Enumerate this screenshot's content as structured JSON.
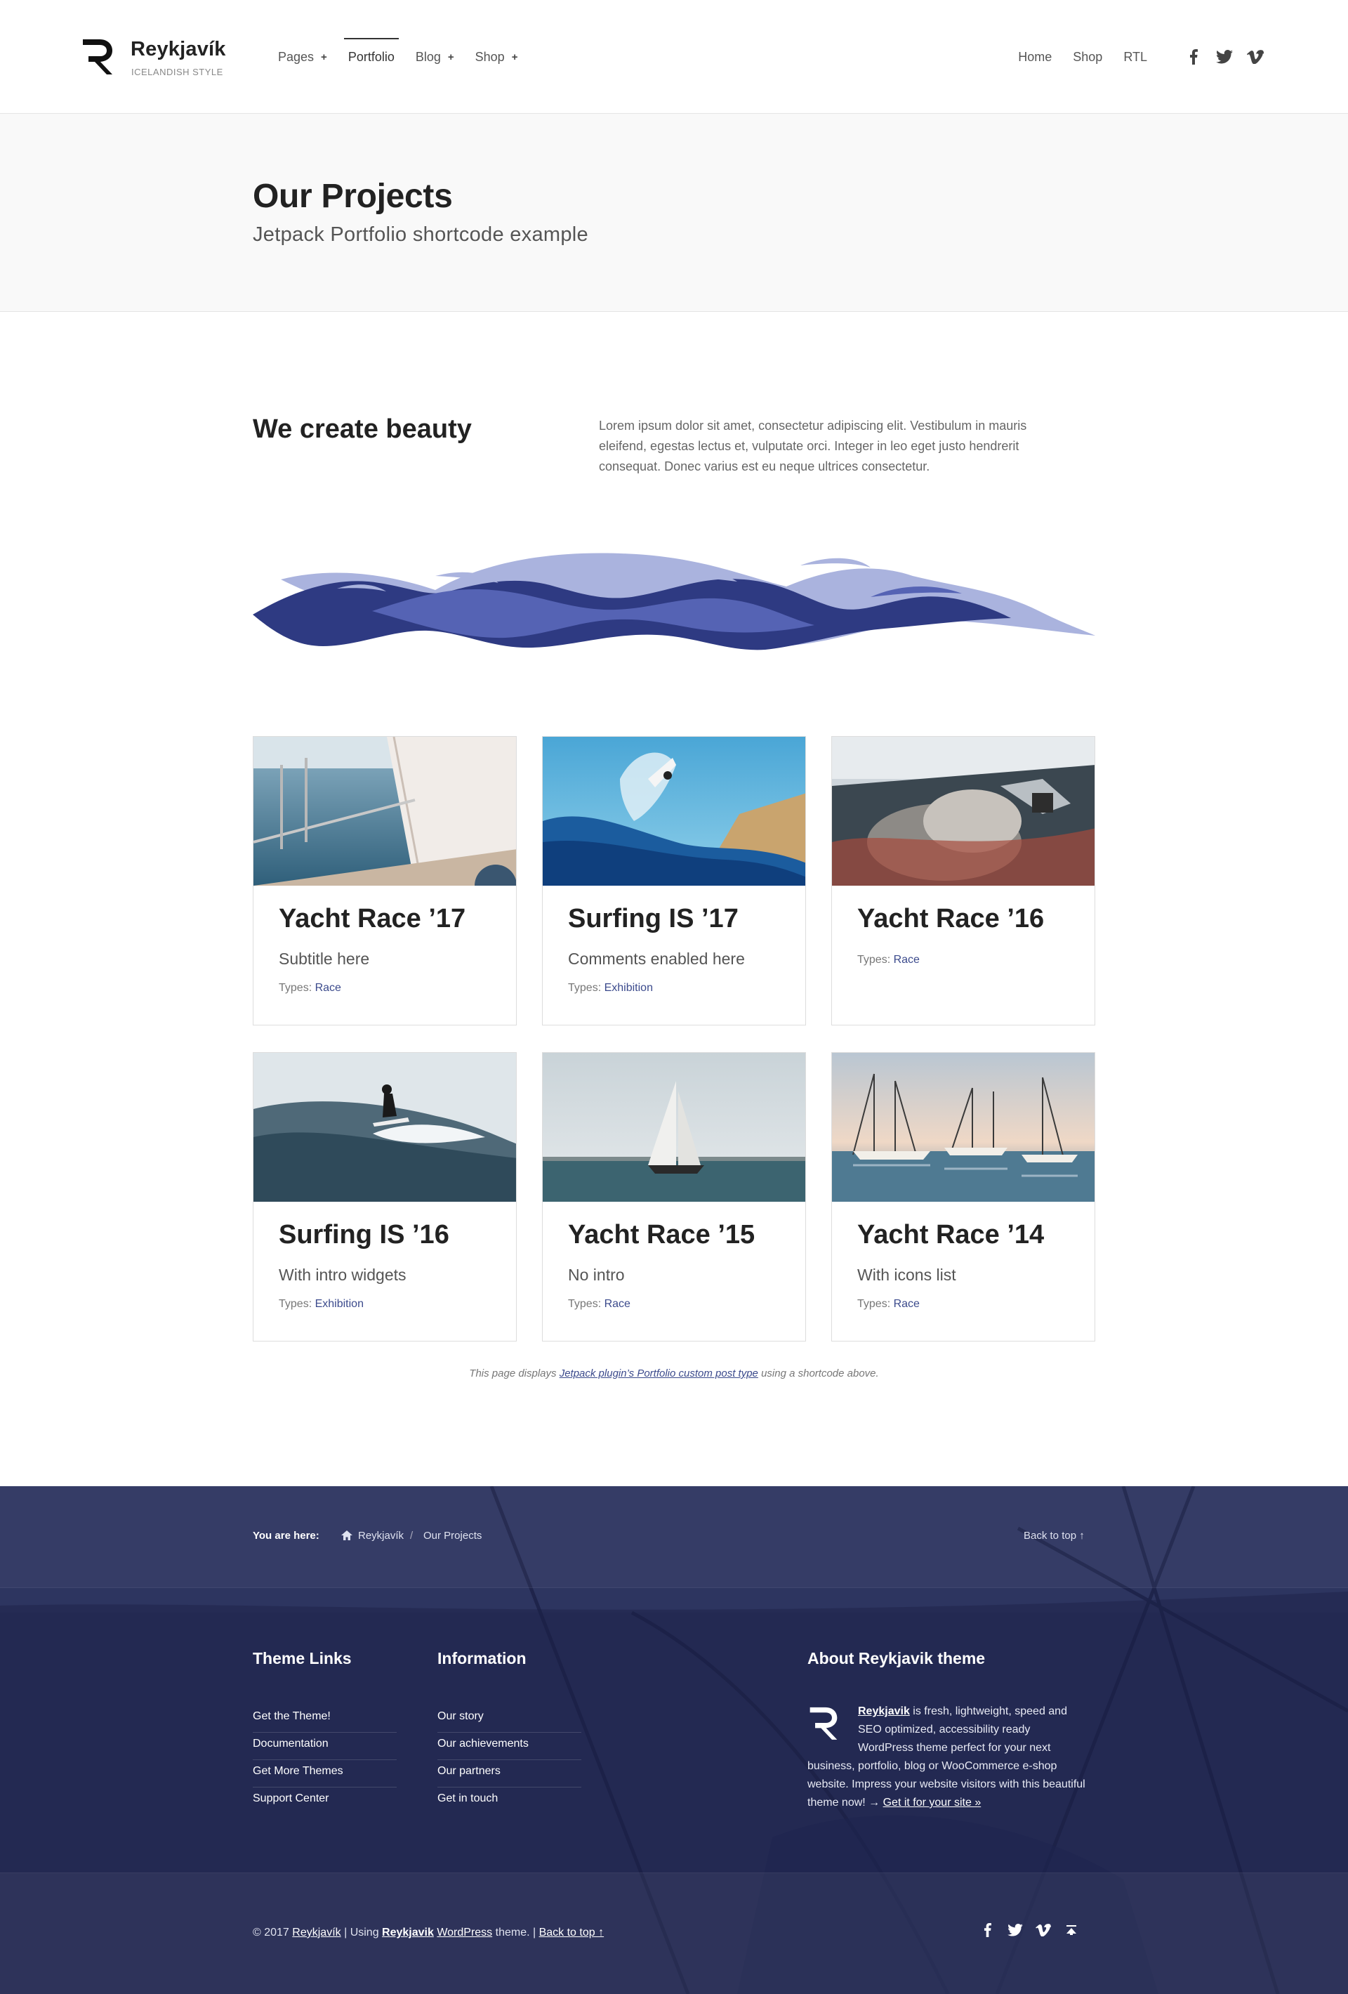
{
  "header": {
    "brand_name": "Reykjavík",
    "brand_tagline": "ICELANDISH STYLE",
    "nav": [
      {
        "label": "Pages",
        "has_sub": true
      },
      {
        "label": "Portfolio",
        "has_sub": false,
        "active": true
      },
      {
        "label": "Blog",
        "has_sub": true
      },
      {
        "label": "Shop",
        "has_sub": true
      }
    ],
    "nav_sub_symbol": "+",
    "secondary_nav": [
      "Home",
      "Shop",
      "RTL"
    ],
    "social_icons": [
      "facebook-icon",
      "twitter-icon",
      "vimeo-icon"
    ]
  },
  "hero": {
    "title": "Our Projects",
    "subtitle": "Jetpack Portfolio shortcode example"
  },
  "intro": {
    "heading": "We create beauty",
    "text": "Lorem ipsum dolor sit amet, consectetur adipiscing elit. Vestibulum in mauris eleifend, egestas lectus et, vulputate orci. Integer in leo eget justo hendrerit consequat. Donec varius est eu neque ultrices consectetur."
  },
  "portfolio": {
    "types_label": "Types:",
    "items": [
      {
        "title": "Yacht Race ’17",
        "subtitle": "Subtitle here",
        "type": "Race",
        "image": "yacht-deck-photo"
      },
      {
        "title": "Surfing IS ’17",
        "subtitle": "Comments enabled here",
        "type": "Exhibition",
        "image": "surfer-aerial-photo"
      },
      {
        "title": "Yacht Race ’16",
        "subtitle": "",
        "type": "Race",
        "image": "yacht-winch-photo"
      },
      {
        "title": "Surfing IS ’16",
        "subtitle": "With intro widgets",
        "type": "Exhibition",
        "image": "surfer-wave-photo"
      },
      {
        "title": "Yacht Race ’15",
        "subtitle": "No intro",
        "type": "Race",
        "image": "sailboat-sea-photo"
      },
      {
        "title": "Yacht Race ’14",
        "subtitle": "With icons list",
        "type": "Race",
        "image": "sailboats-sunset-photo"
      }
    ]
  },
  "note": {
    "prefix": "This page displays ",
    "link": "Jetpack plugin’s Portfolio custom post type",
    "suffix": " using a shortcode above."
  },
  "footer": {
    "breadcrumb_label": "You are here:",
    "breadcrumb_root": "Reykjavík",
    "breadcrumb_sep": "/",
    "breadcrumb_current": "Our Projects",
    "back_to_top": "Back to top ↑",
    "col1_title": "Theme Links",
    "col1_links": [
      "Get the Theme!",
      "Documentation",
      "Get More Themes",
      "Support Center"
    ],
    "col2_title": "Information",
    "col2_links": [
      "Our story",
      "Our achievements",
      "Our partners",
      "Get in touch"
    ],
    "about_title": "About Reykjavik theme",
    "about_brand": "Reykjavik",
    "about_text": " is fresh, lightweight, speed and SEO optimized, accessibility ready WordPress theme perfect for your next business, portfolio, blog or WooCommerce e-shop website. Impress your website visitors with this beautiful theme now! → ",
    "about_cta": "Get it for your site »",
    "copyright_prefix": "© 2017 ",
    "copyright_site": "Reykjavík",
    "copyright_mid": " | Using ",
    "copyright_theme": "Reykjavik",
    "copyright_space": " ",
    "copyright_wp": "WordPress",
    "copyright_suffix": " theme. | ",
    "copyright_back": "Back to top ↑",
    "social_icons": [
      "facebook-icon",
      "twitter-icon",
      "vimeo-icon",
      "back-to-top-icon"
    ]
  },
  "colors": {
    "accent": "#3b4a8c",
    "footer_bg": "#272d57",
    "hero_bg": "#f9f9f9",
    "wave_dark": "#2e3a82",
    "wave_mid": "#5563b4",
    "wave_light": "#aab3de"
  }
}
